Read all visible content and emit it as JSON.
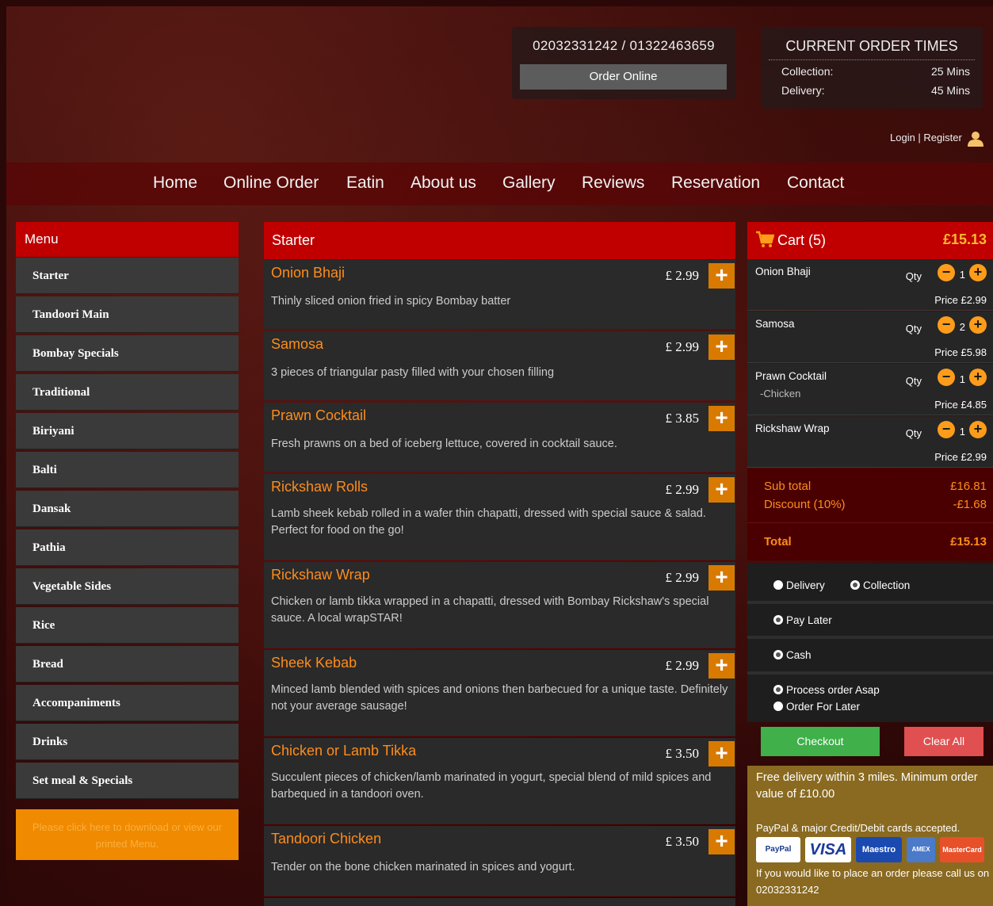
{
  "header": {
    "phone": "02032331242 / 01322463659",
    "order_online": "Order Online",
    "times_title": "CURRENT ORDER TIMES",
    "collection_label": "Collection:",
    "collection_value": "25 Mins",
    "delivery_label": "Delivery:",
    "delivery_value": "45 Mins",
    "login": "Login | Register"
  },
  "nav": [
    "Home",
    "Online Order",
    "Eatin",
    "About us",
    "Gallery",
    "Reviews",
    "Reservation",
    "Contact"
  ],
  "menu": {
    "title": "Menu",
    "items": [
      "Starter",
      "Tandoori Main",
      "Bombay Specials",
      "Traditional",
      "Biriyani",
      "Balti",
      "Dansak",
      "Pathia",
      "Vegetable Sides",
      "Rice",
      "Bread",
      "Accompaniments",
      "Drinks",
      "Set meal & Specials"
    ],
    "download_text": "Please click here to download or view our printed Menu."
  },
  "section": {
    "title": "Starter",
    "dishes": [
      {
        "name": "Onion Bhaji",
        "price": "£ 2.99",
        "desc": "Thinly sliced onion fried in spicy Bombay batter"
      },
      {
        "name": "Samosa",
        "price": "£ 2.99",
        "desc": "3 pieces of triangular pasty filled with your chosen filling"
      },
      {
        "name": "Prawn Cocktail",
        "price": "£ 3.85",
        "desc": "Fresh prawns on a bed of iceberg lettuce, covered in cocktail sauce."
      },
      {
        "name": "Rickshaw Rolls",
        "price": "£ 2.99",
        "desc": "Lamb sheek kebab rolled in a wafer thin chapatti, dressed with special sauce & salad. Perfect for food on the go!"
      },
      {
        "name": "Rickshaw Wrap",
        "price": "£ 2.99",
        "desc": "Chicken or lamb tikka wrapped in a chapatti, dressed with Bombay Rickshaw's special sauce. A local wrapSTAR!"
      },
      {
        "name": "Sheek Kebab",
        "price": "£ 2.99",
        "desc": "Minced lamb blended with spices and onions then barbecued for a unique taste. Definitely not your average sausage!"
      },
      {
        "name": "Chicken or Lamb Tikka",
        "price": "£ 3.50",
        "desc": "Succulent pieces of chicken/lamb marinated in yogurt, special blend of mild spices and barbequed in a tandoori oven."
      },
      {
        "name": "Tandoori Chicken",
        "price": "£ 3.50",
        "desc": "Tender on the bone chicken marinated in spices and yogurt."
      }
    ]
  },
  "cart": {
    "title": "Cart (5)",
    "total": "£15.13",
    "qty_label": "Qty",
    "items": [
      {
        "name": "Onion Bhaji",
        "sub": "",
        "qty": "1",
        "price": "Price £2.99"
      },
      {
        "name": "Samosa",
        "sub": "",
        "qty": "2",
        "price": "Price £5.98"
      },
      {
        "name": "Prawn Cocktail",
        "sub": "-Chicken",
        "qty": "1",
        "price": "Price £4.85"
      },
      {
        "name": "Rickshaw Wrap",
        "sub": "",
        "qty": "1",
        "price": "Price £2.99"
      }
    ],
    "subtotal_label": "Sub total",
    "subtotal_value": "£16.81",
    "discount_label": "Discount (10%)",
    "discount_value": "-£1.68",
    "total_label": "Total",
    "total_value": "£15.13",
    "options": {
      "delivery": "Delivery",
      "collection": "Collection",
      "pay_later": "Pay Later",
      "cash": "Cash",
      "process_asap": "Process order Asap",
      "order_later": "Order For Later"
    },
    "checkout": "Checkout",
    "clear_all": "Clear All",
    "free_delivery": "Free delivery within 3 miles. Minimum order value of £10.00",
    "paypal_text": "PayPal & major Credit/Debit cards accepted.",
    "cards": [
      "PayPal",
      "VISA",
      "Maestro",
      "AMEX",
      "MasterCard"
    ],
    "call_text": "If you would like to place an order please call us on 02032331242"
  },
  "colors": {
    "accent_red": "#c00000",
    "accent_orange": "#ff8c1a",
    "checkout_green": "#3fb04a",
    "clear_red": "#e05050"
  }
}
